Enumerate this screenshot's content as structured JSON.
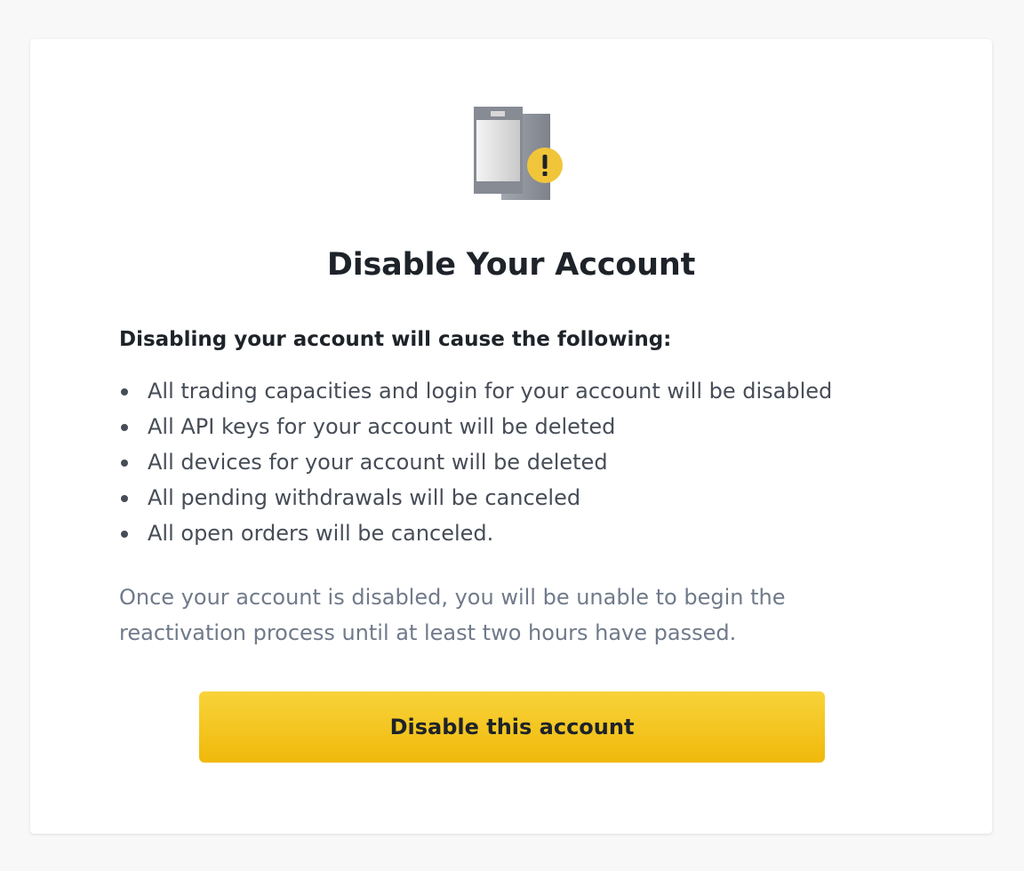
{
  "dialog": {
    "illustration_icon": "phone-warning-icon",
    "title": "Disable Your Account",
    "intro": "Disabling your account will cause the following:",
    "consequences": [
      "All trading capacities and login for your account will be disabled",
      "All API keys for your account will be deleted",
      "All devices for your account will be deleted",
      "All pending withdrawals will be canceled",
      "All open orders will be canceled."
    ],
    "note": "Once your account is disabled, you will be unable to begin the reactivation process until at least two hours have passed.",
    "confirm_label": "Disable this account"
  },
  "colors": {
    "page_background": "#f8f8f8",
    "card_background": "#ffffff",
    "heading_text": "#1e2329",
    "body_text": "#474d57",
    "muted_text": "#707a8a",
    "accent_yellow": "#f0b90b",
    "device_gray": "#8a8f99"
  }
}
